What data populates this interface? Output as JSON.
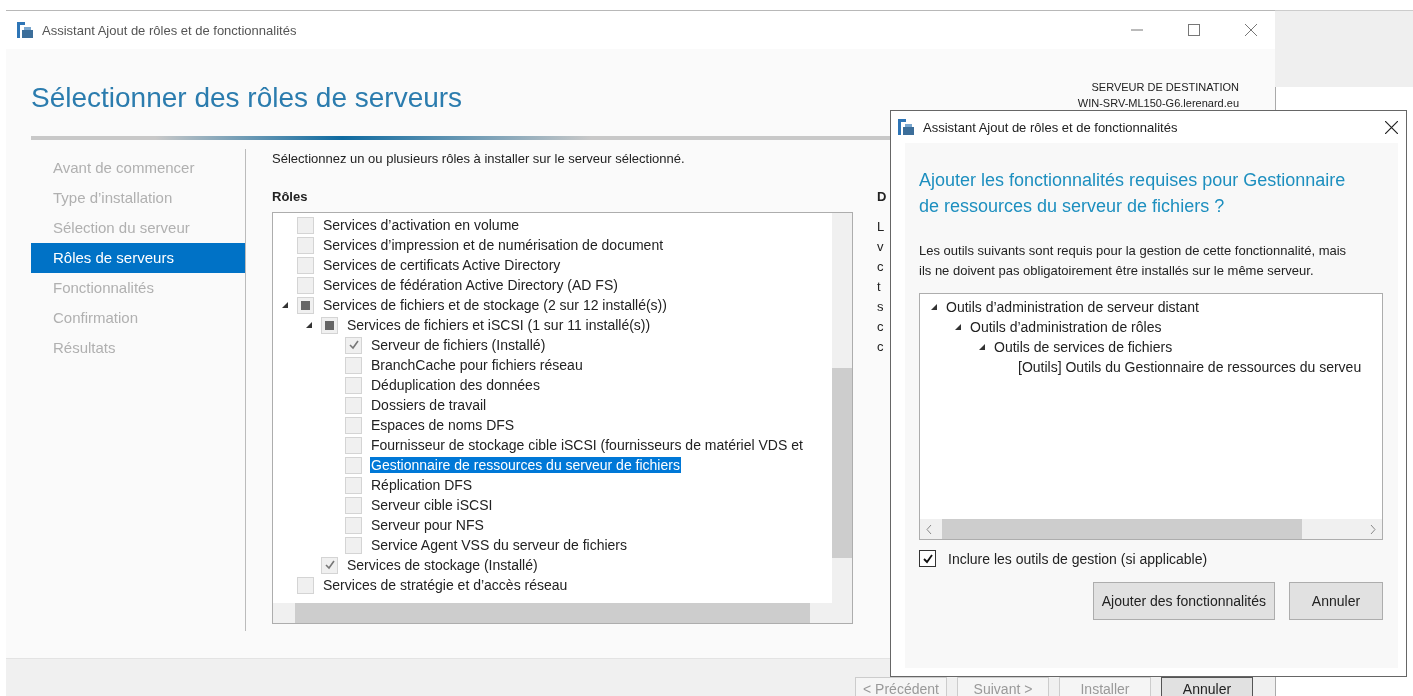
{
  "window": {
    "title": "Assistant Ajout de rôles et de fonctionnalités"
  },
  "page_title": "Sélectionner des rôles de serveurs",
  "destination": {
    "label": "SERVEUR DE DESTINATION",
    "server": "WIN-SRV-ML150-G6.lerenard.eu"
  },
  "sidebar": {
    "items": [
      {
        "label": "Avant de commencer",
        "selected": false
      },
      {
        "label": "Type d’installation",
        "selected": false
      },
      {
        "label": "Sélection du serveur",
        "selected": false
      },
      {
        "label": "Rôles de serveurs",
        "selected": true
      },
      {
        "label": "Fonctionnalités",
        "selected": false
      },
      {
        "label": "Confirmation",
        "selected": false
      },
      {
        "label": "Résultats",
        "selected": false
      }
    ]
  },
  "instruction": "Sélectionnez un ou plusieurs rôles à installer sur le serveur sélectionné.",
  "roles_label": "Rôles",
  "roles": [
    {
      "label": "Services d’activation en volume",
      "checked": false,
      "partial": false,
      "selected": false
    },
    {
      "label": "Services d’impression et de numérisation de document",
      "checked": false,
      "partial": false,
      "selected": false
    },
    {
      "label": "Services de certificats Active Directory",
      "checked": false,
      "partial": false,
      "selected": false
    },
    {
      "label": "Services de fédération Active Directory (AD FS)",
      "checked": false,
      "partial": false,
      "selected": false
    },
    {
      "label": "Services de fichiers et de stockage (2 sur 12 installé(s))",
      "checked": false,
      "partial": true,
      "selected": false,
      "expanded": true,
      "children": [
        {
          "label": "Services de fichiers et iSCSI (1 sur 11 installé(s))",
          "checked": false,
          "partial": true,
          "selected": false,
          "expanded": true,
          "children": [
            {
              "label": "Serveur de fichiers (Installé)",
              "checked": true,
              "partial": false,
              "selected": false
            },
            {
              "label": "BranchCache pour fichiers réseau",
              "checked": false,
              "partial": false,
              "selected": false
            },
            {
              "label": "Déduplication des données",
              "checked": false,
              "partial": false,
              "selected": false
            },
            {
              "label": "Dossiers de travail",
              "checked": false,
              "partial": false,
              "selected": false
            },
            {
              "label": "Espaces de noms DFS",
              "checked": false,
              "partial": false,
              "selected": false
            },
            {
              "label": "Fournisseur de stockage cible iSCSI (fournisseurs de matériel VDS et",
              "checked": false,
              "partial": false,
              "selected": false
            },
            {
              "label": "Gestionnaire de ressources du serveur de fichiers",
              "checked": false,
              "partial": false,
              "selected": true
            },
            {
              "label": "Réplication DFS",
              "checked": false,
              "partial": false,
              "selected": false
            },
            {
              "label": "Serveur cible iSCSI",
              "checked": false,
              "partial": false,
              "selected": false
            },
            {
              "label": "Serveur pour NFS",
              "checked": false,
              "partial": false,
              "selected": false
            },
            {
              "label": "Service Agent VSS du serveur de fichiers",
              "checked": false,
              "partial": false,
              "selected": false
            }
          ]
        },
        {
          "label": "Services de stockage (Installé)",
          "checked": true,
          "partial": false,
          "selected": false
        }
      ]
    },
    {
      "label": "Services de stratégie et d’accès réseau",
      "checked": false,
      "partial": false,
      "selected": false
    }
  ],
  "description": {
    "heading": "D",
    "lines": [
      "L",
      "v",
      "c",
      "t",
      "s",
      "c",
      "c"
    ]
  },
  "footer_buttons": [
    {
      "label": "< Précédent",
      "disabled": true,
      "default": false
    },
    {
      "label": "Suivant >",
      "disabled": true,
      "default": false
    },
    {
      "label": "Installer",
      "disabled": true,
      "default": false
    },
    {
      "label": "Annuler",
      "disabled": false,
      "default": true
    }
  ],
  "dialog": {
    "title": "Assistant Ajout de rôles et de fonctionnalités",
    "heading": "Ajouter les fonctionnalités requises pour Gestionnaire de ressources du serveur de fichiers ?",
    "text": "Les outils suivants sont requis pour la gestion de cette fonctionnalité, mais ils ne doivent pas obligatoirement être installés sur le même serveur.",
    "tree": [
      {
        "label": "Outils d’administration de serveur distant",
        "expanded": true,
        "children": [
          {
            "label": "Outils d’administration de rôles",
            "expanded": true,
            "children": [
              {
                "label": "Outils de services de fichiers",
                "expanded": true,
                "children": [
                  {
                    "label": "[Outils] Outils du Gestionnaire de ressources du serveu"
                  }
                ]
              }
            ]
          }
        ]
      }
    ],
    "include_tools": {
      "label": "Inclure les outils de gestion (si applicable)",
      "checked": true
    },
    "buttons": [
      {
        "label": "Ajouter des fonctionnalités"
      },
      {
        "label": "Annuler"
      }
    ]
  }
}
